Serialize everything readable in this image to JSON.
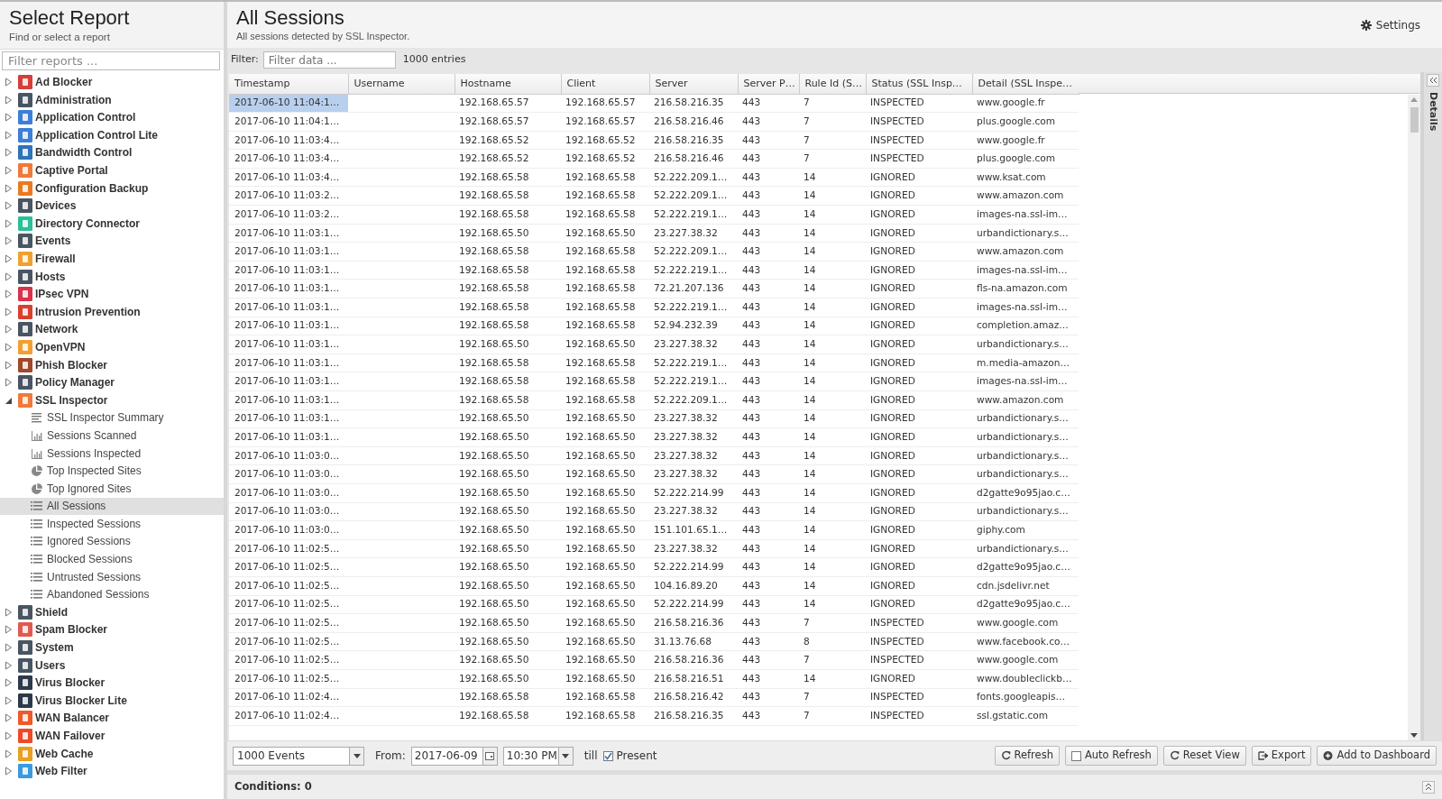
{
  "sidebar": {
    "title": "Select Report",
    "subtitle": "Find or select a report",
    "filter": {
      "placeholder": "Filter reports ..."
    },
    "items": [
      {
        "label": "Ad Blocker",
        "color": "#d43f3a",
        "expanded": false
      },
      {
        "label": "Administration",
        "color": "#4a5563",
        "expanded": false
      },
      {
        "label": "Application Control",
        "color": "#3d7fd6",
        "expanded": false
      },
      {
        "label": "Application Control Lite",
        "color": "#3d7fd6",
        "expanded": false
      },
      {
        "label": "Bandwidth Control",
        "color": "#2f73b8",
        "expanded": false
      },
      {
        "label": "Captive Portal",
        "color": "#ee7a3a",
        "expanded": false
      },
      {
        "label": "Configuration Backup",
        "color": "#e87a22",
        "expanded": false
      },
      {
        "label": "Devices",
        "color": "#4a5563",
        "expanded": false
      },
      {
        "label": "Directory Connector",
        "color": "#2bbf9a",
        "expanded": false
      },
      {
        "label": "Events",
        "color": "#4a5563",
        "expanded": false
      },
      {
        "label": "Firewall",
        "color": "#f0a030",
        "expanded": false
      },
      {
        "label": "Hosts",
        "color": "#4a5563",
        "expanded": false
      },
      {
        "label": "IPsec VPN",
        "color": "#d8334a",
        "expanded": false
      },
      {
        "label": "Intrusion Prevention",
        "color": "#d8402f",
        "expanded": false
      },
      {
        "label": "Network",
        "color": "#4a5563",
        "expanded": false
      },
      {
        "label": "OpenVPN",
        "color": "#f0a030",
        "expanded": false
      },
      {
        "label": "Phish Blocker",
        "color": "#a0482a",
        "expanded": false
      },
      {
        "label": "Policy Manager",
        "color": "#4a5563",
        "expanded": false
      },
      {
        "label": "SSL Inspector",
        "color": "#f07a3a",
        "expanded": true,
        "children": [
          {
            "label": "SSL Inspector Summary",
            "kind": "summary",
            "selected": false
          },
          {
            "label": "Sessions Scanned",
            "kind": "bar",
            "selected": false
          },
          {
            "label": "Sessions Inspected",
            "kind": "bar",
            "selected": false
          },
          {
            "label": "Top Inspected Sites",
            "kind": "pie",
            "selected": false
          },
          {
            "label": "Top Ignored Sites",
            "kind": "pie",
            "selected": false
          },
          {
            "label": "All Sessions",
            "kind": "list",
            "selected": true
          },
          {
            "label": "Inspected Sessions",
            "kind": "list",
            "selected": false
          },
          {
            "label": "Ignored Sessions",
            "kind": "list",
            "selected": false
          },
          {
            "label": "Blocked Sessions",
            "kind": "list",
            "selected": false
          },
          {
            "label": "Untrusted Sessions",
            "kind": "list",
            "selected": false
          },
          {
            "label": "Abandoned Sessions",
            "kind": "list",
            "selected": false
          }
        ]
      },
      {
        "label": "Shield",
        "color": "#4a5563",
        "expanded": false
      },
      {
        "label": "Spam Blocker",
        "color": "#e05a50",
        "expanded": false
      },
      {
        "label": "System",
        "color": "#4a5563",
        "expanded": false
      },
      {
        "label": "Users",
        "color": "#4a5563",
        "expanded": false
      },
      {
        "label": "Virus Blocker",
        "color": "#2c3a4a",
        "expanded": false
      },
      {
        "label": "Virus Blocker Lite",
        "color": "#2c3a4a",
        "expanded": false
      },
      {
        "label": "WAN Balancer",
        "color": "#ee5a2a",
        "expanded": false
      },
      {
        "label": "WAN Failover",
        "color": "#ee4a2a",
        "expanded": false
      },
      {
        "label": "Web Cache",
        "color": "#e8a020",
        "expanded": false
      },
      {
        "label": "Web Filter",
        "color": "#3a9ae0",
        "expanded": false
      }
    ]
  },
  "report": {
    "title": "All Sessions",
    "subtitle": "All sessions detected by SSL Inspector.",
    "settings": "Settings"
  },
  "filter": {
    "label": "Filter:",
    "placeholder": "Filter data ...",
    "count": "1000 entries"
  },
  "table": {
    "columns": [
      "Timestamp",
      "Username",
      "Hostname",
      "Client",
      "Server",
      "Server P…",
      "Rule Id (S…",
      "Status (SSL Insp…",
      "Detail (SSL Inspe…"
    ],
    "rows": [
      {
        "selected": true,
        "timestamp": "2017-06-10 11:04:1…",
        "hostname": "192.168.65.57",
        "client": "192.168.65.57",
        "server": "216.58.216.35",
        "port": "443",
        "rule": "7",
        "status": "INSPECTED",
        "detail": "www.google.fr"
      },
      {
        "selected": false,
        "timestamp": "2017-06-10 11:04:1…",
        "hostname": "192.168.65.57",
        "client": "192.168.65.57",
        "server": "216.58.216.46",
        "port": "443",
        "rule": "7",
        "status": "INSPECTED",
        "detail": "plus.google.com"
      },
      {
        "selected": false,
        "timestamp": "2017-06-10 11:03:4…",
        "hostname": "192.168.65.52",
        "client": "192.168.65.52",
        "server": "216.58.216.35",
        "port": "443",
        "rule": "7",
        "status": "INSPECTED",
        "detail": "www.google.fr"
      },
      {
        "selected": false,
        "timestamp": "2017-06-10 11:03:4…",
        "hostname": "192.168.65.52",
        "client": "192.168.65.52",
        "server": "216.58.216.46",
        "port": "443",
        "rule": "7",
        "status": "INSPECTED",
        "detail": "plus.google.com"
      },
      {
        "selected": false,
        "timestamp": "2017-06-10 11:03:4…",
        "hostname": "192.168.65.58",
        "client": "192.168.65.58",
        "server": "52.222.209.1…",
        "port": "443",
        "rule": "14",
        "status": "IGNORED",
        "detail": "www.ksat.com"
      },
      {
        "selected": false,
        "timestamp": "2017-06-10 11:03:2…",
        "hostname": "192.168.65.58",
        "client": "192.168.65.58",
        "server": "52.222.209.1…",
        "port": "443",
        "rule": "14",
        "status": "IGNORED",
        "detail": "www.amazon.com"
      },
      {
        "selected": false,
        "timestamp": "2017-06-10 11:03:2…",
        "hostname": "192.168.65.58",
        "client": "192.168.65.58",
        "server": "52.222.219.1…",
        "port": "443",
        "rule": "14",
        "status": "IGNORED",
        "detail": "images-na.ssl-im…"
      },
      {
        "selected": false,
        "timestamp": "2017-06-10 11:03:1…",
        "hostname": "192.168.65.50",
        "client": "192.168.65.50",
        "server": "23.227.38.32",
        "port": "443",
        "rule": "14",
        "status": "IGNORED",
        "detail": "urbandictionary.s…"
      },
      {
        "selected": false,
        "timestamp": "2017-06-10 11:03:1…",
        "hostname": "192.168.65.58",
        "client": "192.168.65.58",
        "server": "52.222.209.1…",
        "port": "443",
        "rule": "14",
        "status": "IGNORED",
        "detail": "www.amazon.com"
      },
      {
        "selected": false,
        "timestamp": "2017-06-10 11:03:1…",
        "hostname": "192.168.65.58",
        "client": "192.168.65.58",
        "server": "52.222.219.1…",
        "port": "443",
        "rule": "14",
        "status": "IGNORED",
        "detail": "images-na.ssl-im…"
      },
      {
        "selected": false,
        "timestamp": "2017-06-10 11:03:1…",
        "hostname": "192.168.65.58",
        "client": "192.168.65.58",
        "server": "72.21.207.136",
        "port": "443",
        "rule": "14",
        "status": "IGNORED",
        "detail": "fls-na.amazon.com"
      },
      {
        "selected": false,
        "timestamp": "2017-06-10 11:03:1…",
        "hostname": "192.168.65.58",
        "client": "192.168.65.58",
        "server": "52.222.219.1…",
        "port": "443",
        "rule": "14",
        "status": "IGNORED",
        "detail": "images-na.ssl-im…"
      },
      {
        "selected": false,
        "timestamp": "2017-06-10 11:03:1…",
        "hostname": "192.168.65.58",
        "client": "192.168.65.58",
        "server": "52.94.232.39",
        "port": "443",
        "rule": "14",
        "status": "IGNORED",
        "detail": "completion.amaz…"
      },
      {
        "selected": false,
        "timestamp": "2017-06-10 11:03:1…",
        "hostname": "192.168.65.50",
        "client": "192.168.65.50",
        "server": "23.227.38.32",
        "port": "443",
        "rule": "14",
        "status": "IGNORED",
        "detail": "urbandictionary.s…"
      },
      {
        "selected": false,
        "timestamp": "2017-06-10 11:03:1…",
        "hostname": "192.168.65.58",
        "client": "192.168.65.58",
        "server": "52.222.219.1…",
        "port": "443",
        "rule": "14",
        "status": "IGNORED",
        "detail": "m.media-amazon…"
      },
      {
        "selected": false,
        "timestamp": "2017-06-10 11:03:1…",
        "hostname": "192.168.65.58",
        "client": "192.168.65.58",
        "server": "52.222.219.1…",
        "port": "443",
        "rule": "14",
        "status": "IGNORED",
        "detail": "images-na.ssl-im…"
      },
      {
        "selected": false,
        "timestamp": "2017-06-10 11:03:1…",
        "hostname": "192.168.65.58",
        "client": "192.168.65.58",
        "server": "52.222.209.1…",
        "port": "443",
        "rule": "14",
        "status": "IGNORED",
        "detail": "www.amazon.com"
      },
      {
        "selected": false,
        "timestamp": "2017-06-10 11:03:1…",
        "hostname": "192.168.65.50",
        "client": "192.168.65.50",
        "server": "23.227.38.32",
        "port": "443",
        "rule": "14",
        "status": "IGNORED",
        "detail": "urbandictionary.s…"
      },
      {
        "selected": false,
        "timestamp": "2017-06-10 11:03:1…",
        "hostname": "192.168.65.50",
        "client": "192.168.65.50",
        "server": "23.227.38.32",
        "port": "443",
        "rule": "14",
        "status": "IGNORED",
        "detail": "urbandictionary.s…"
      },
      {
        "selected": false,
        "timestamp": "2017-06-10 11:03:0…",
        "hostname": "192.168.65.50",
        "client": "192.168.65.50",
        "server": "23.227.38.32",
        "port": "443",
        "rule": "14",
        "status": "IGNORED",
        "detail": "urbandictionary.s…"
      },
      {
        "selected": false,
        "timestamp": "2017-06-10 11:03:0…",
        "hostname": "192.168.65.50",
        "client": "192.168.65.50",
        "server": "23.227.38.32",
        "port": "443",
        "rule": "14",
        "status": "IGNORED",
        "detail": "urbandictionary.s…"
      },
      {
        "selected": false,
        "timestamp": "2017-06-10 11:03:0…",
        "hostname": "192.168.65.50",
        "client": "192.168.65.50",
        "server": "52.222.214.99",
        "port": "443",
        "rule": "14",
        "status": "IGNORED",
        "detail": "d2gatte9o95jao.c…"
      },
      {
        "selected": false,
        "timestamp": "2017-06-10 11:03:0…",
        "hostname": "192.168.65.50",
        "client": "192.168.65.50",
        "server": "23.227.38.32",
        "port": "443",
        "rule": "14",
        "status": "IGNORED",
        "detail": "urbandictionary.s…"
      },
      {
        "selected": false,
        "timestamp": "2017-06-10 11:03:0…",
        "hostname": "192.168.65.50",
        "client": "192.168.65.50",
        "server": "151.101.65.1…",
        "port": "443",
        "rule": "14",
        "status": "IGNORED",
        "detail": "giphy.com"
      },
      {
        "selected": false,
        "timestamp": "2017-06-10 11:02:5…",
        "hostname": "192.168.65.50",
        "client": "192.168.65.50",
        "server": "23.227.38.32",
        "port": "443",
        "rule": "14",
        "status": "IGNORED",
        "detail": "urbandictionary.s…"
      },
      {
        "selected": false,
        "timestamp": "2017-06-10 11:02:5…",
        "hostname": "192.168.65.50",
        "client": "192.168.65.50",
        "server": "52.222.214.99",
        "port": "443",
        "rule": "14",
        "status": "IGNORED",
        "detail": "d2gatte9o95jao.c…"
      },
      {
        "selected": false,
        "timestamp": "2017-06-10 11:02:5…",
        "hostname": "192.168.65.50",
        "client": "192.168.65.50",
        "server": "104.16.89.20",
        "port": "443",
        "rule": "14",
        "status": "IGNORED",
        "detail": "cdn.jsdelivr.net"
      },
      {
        "selected": false,
        "timestamp": "2017-06-10 11:02:5…",
        "hostname": "192.168.65.50",
        "client": "192.168.65.50",
        "server": "52.222.214.99",
        "port": "443",
        "rule": "14",
        "status": "IGNORED",
        "detail": "d2gatte9o95jao.c…"
      },
      {
        "selected": false,
        "timestamp": "2017-06-10 11:02:5…",
        "hostname": "192.168.65.50",
        "client": "192.168.65.50",
        "server": "216.58.216.36",
        "port": "443",
        "rule": "7",
        "status": "INSPECTED",
        "detail": "www.google.com"
      },
      {
        "selected": false,
        "timestamp": "2017-06-10 11:02:5…",
        "hostname": "192.168.65.50",
        "client": "192.168.65.50",
        "server": "31.13.76.68",
        "port": "443",
        "rule": "8",
        "status": "INSPECTED",
        "detail": "www.facebook.co…"
      },
      {
        "selected": false,
        "timestamp": "2017-06-10 11:02:5…",
        "hostname": "192.168.65.50",
        "client": "192.168.65.50",
        "server": "216.58.216.36",
        "port": "443",
        "rule": "7",
        "status": "INSPECTED",
        "detail": "www.google.com"
      },
      {
        "selected": false,
        "timestamp": "2017-06-10 11:02:5…",
        "hostname": "192.168.65.50",
        "client": "192.168.65.50",
        "server": "216.58.216.51",
        "port": "443",
        "rule": "14",
        "status": "IGNORED",
        "detail": "www.doubleclickb…"
      },
      {
        "selected": false,
        "timestamp": "2017-06-10 11:02:4…",
        "hostname": "192.168.65.58",
        "client": "192.168.65.58",
        "server": "216.58.216.42",
        "port": "443",
        "rule": "7",
        "status": "INSPECTED",
        "detail": "fonts.googleapis…"
      },
      {
        "selected": false,
        "timestamp": "2017-06-10 11:02:4…",
        "hostname": "192.168.65.58",
        "client": "192.168.65.58",
        "server": "216.58.216.35",
        "port": "443",
        "rule": "7",
        "status": "INSPECTED",
        "detail": "ssl.gstatic.com"
      }
    ]
  },
  "details_tab": "Details",
  "toolbar": {
    "events": "1000 Events",
    "from_label": "From:",
    "date": "2017-06-09",
    "time": "10:30 PM",
    "till_label": "till",
    "present": {
      "label": "Present",
      "checked": true
    },
    "buttons": [
      {
        "label": "Refresh",
        "kind": "refresh"
      },
      {
        "label": "Auto Refresh",
        "kind": "checkbox",
        "checked": false
      },
      {
        "label": "Reset View",
        "kind": "refresh"
      },
      {
        "label": "Export",
        "kind": "export"
      },
      {
        "label": "Add to Dashboard",
        "kind": "add"
      }
    ]
  },
  "conditions": "Conditions: 0"
}
